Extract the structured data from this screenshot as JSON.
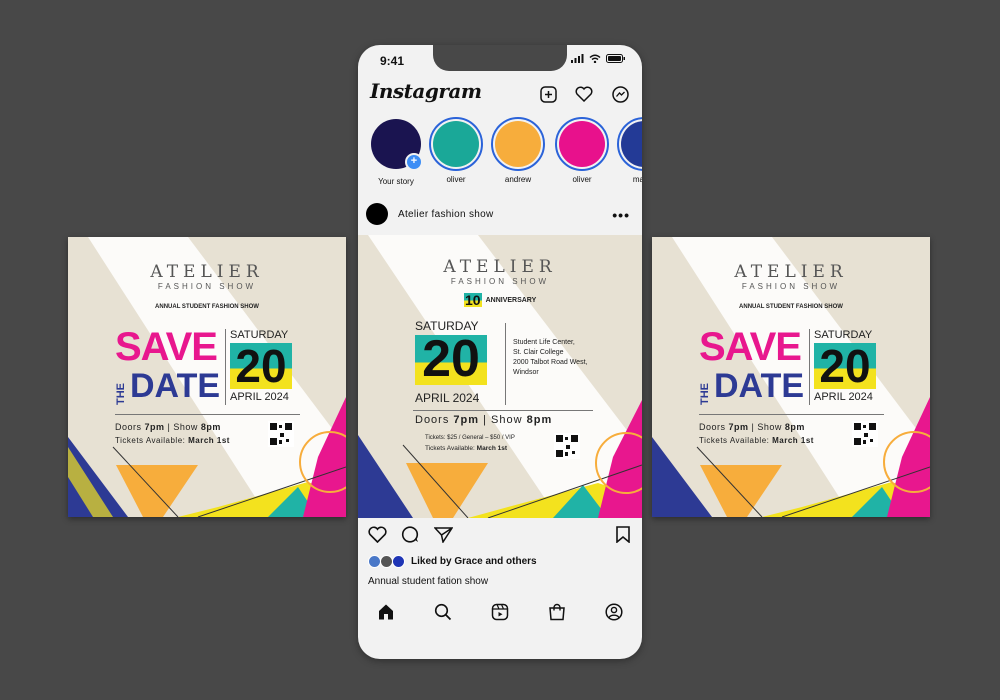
{
  "status_bar": {
    "time": "9:41"
  },
  "app": {
    "name": "Instagram"
  },
  "stories": [
    {
      "name": "Your story",
      "color": "#1a1450"
    },
    {
      "name": "oliver",
      "color": "#1aa898"
    },
    {
      "name": "andrew",
      "color": "#f7ad3c"
    },
    {
      "name": "oliver",
      "color": "#e8118c"
    },
    {
      "name": "mateo",
      "color": "#233a96"
    }
  ],
  "post": {
    "username": "Atelier fashion show",
    "likes_text": "Liked by Grace and others",
    "caption": "Annual student fation show"
  },
  "poster_side": {
    "brand": "ATELIER",
    "brand_sub": "FASHION SHOW",
    "tagline": "ANNUAL STUDENT FASHION SHOW",
    "save": "SAVE",
    "the": "THE",
    "date_word": "DATE",
    "weekday": "SATURDAY",
    "day": "20",
    "month_year": "APRIL 2024",
    "doors_label": "Doors",
    "doors_time": "7pm",
    "show_label": "Show",
    "show_time": "8pm",
    "tickets_label": "Tickets Available:",
    "tickets_date": "March 1st"
  },
  "poster_center": {
    "brand": "ATELIER",
    "brand_sub": "FASHION SHOW",
    "anniversary_num": "10",
    "anniversary": "ANNIVERSARY",
    "weekday": "SATURDAY",
    "day": "20",
    "month_year": "APRIL 2024",
    "venue_1": "Student Life Center,",
    "venue_2": "St. Clair College",
    "venue_3": "2000 Talbot Road West,",
    "venue_4": "Windsor",
    "doors_label": "Doors",
    "doors_time": "7pm",
    "show_label": "Show",
    "show_time": "8pm",
    "prices": "Tickets: $25 / General – $50 / VIP",
    "tickets_label": "Tickets Available:",
    "tickets_date": "March 1st"
  },
  "colors": {
    "pink": "#e8178e",
    "navy": "#2d3a94",
    "teal": "#20b3a6",
    "yellow": "#f3e21e",
    "orange": "#f7ad3c",
    "cream": "#e7e1d3"
  }
}
